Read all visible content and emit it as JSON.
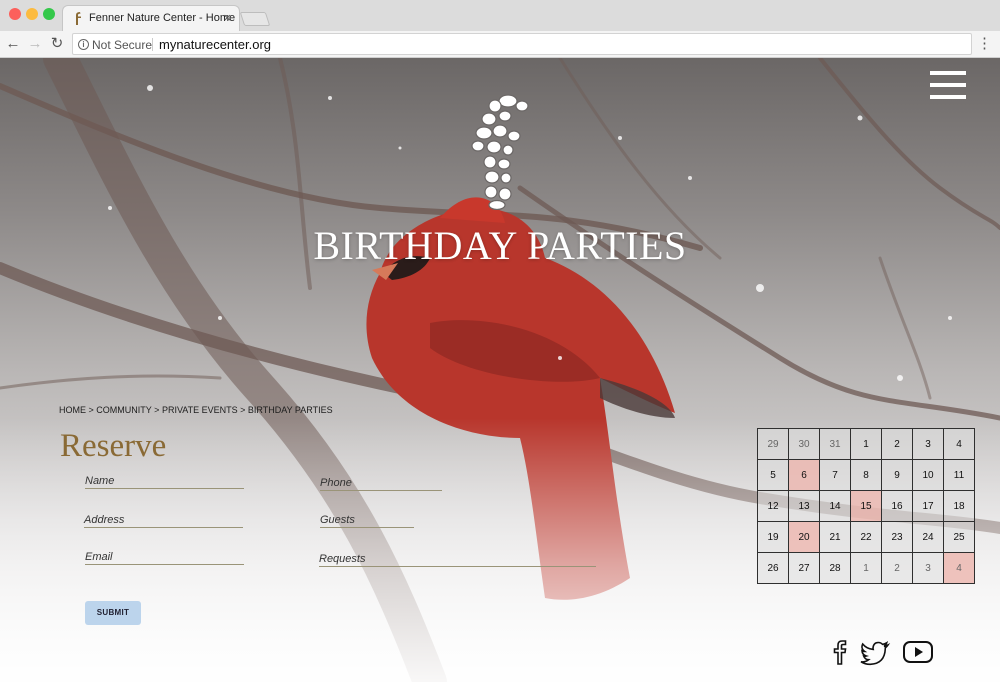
{
  "browser": {
    "tab_title": "Fenner Nature Center - Home",
    "tab_close": "×",
    "security_label": "Not Secure",
    "url": "mynaturecenter.org",
    "back_glyph": "←",
    "forward_glyph": "→",
    "reload_glyph": "↻",
    "menu_glyph": "⋮",
    "info_glyph": "i"
  },
  "hero": {
    "title": "BIRTHDAY PARTIES",
    "logo_icon": "stone-f-logo-icon",
    "menu_icon": "hamburger-menu-icon"
  },
  "breadcrumb": {
    "items": [
      "HOME",
      "COMMUNITY",
      "PRIVATE EVENTS",
      "BIRTHDAY PARTIES"
    ],
    "separator": ">"
  },
  "reserve": {
    "heading": "Reserve",
    "fields": {
      "name": "Name",
      "phone": "Phone",
      "address": "Address",
      "guests": "Guests",
      "email": "Email",
      "requests": "Requests"
    },
    "submit": "SUBMIT"
  },
  "calendar": {
    "weeks": [
      [
        "29",
        "30",
        "31",
        "1",
        "2",
        "3",
        "4"
      ],
      [
        "5",
        "6",
        "7",
        "8",
        "9",
        "10",
        "11"
      ],
      [
        "12",
        "13",
        "14",
        "15",
        "16",
        "17",
        "18"
      ],
      [
        "19",
        "20",
        "21",
        "22",
        "23",
        "24",
        "25"
      ],
      [
        "26",
        "27",
        "28",
        "1",
        "2",
        "3",
        "4"
      ]
    ],
    "highlighted": [
      "6",
      "15",
      "20"
    ],
    "event_color": "#ecb8b2"
  },
  "social": {
    "icons": [
      "facebook-icon",
      "twitter-icon",
      "youtube-icon"
    ]
  },
  "colors": {
    "accent": "#8a6a35",
    "submit_bg": "#bcd4ec",
    "cardinal": "#b8362c"
  }
}
